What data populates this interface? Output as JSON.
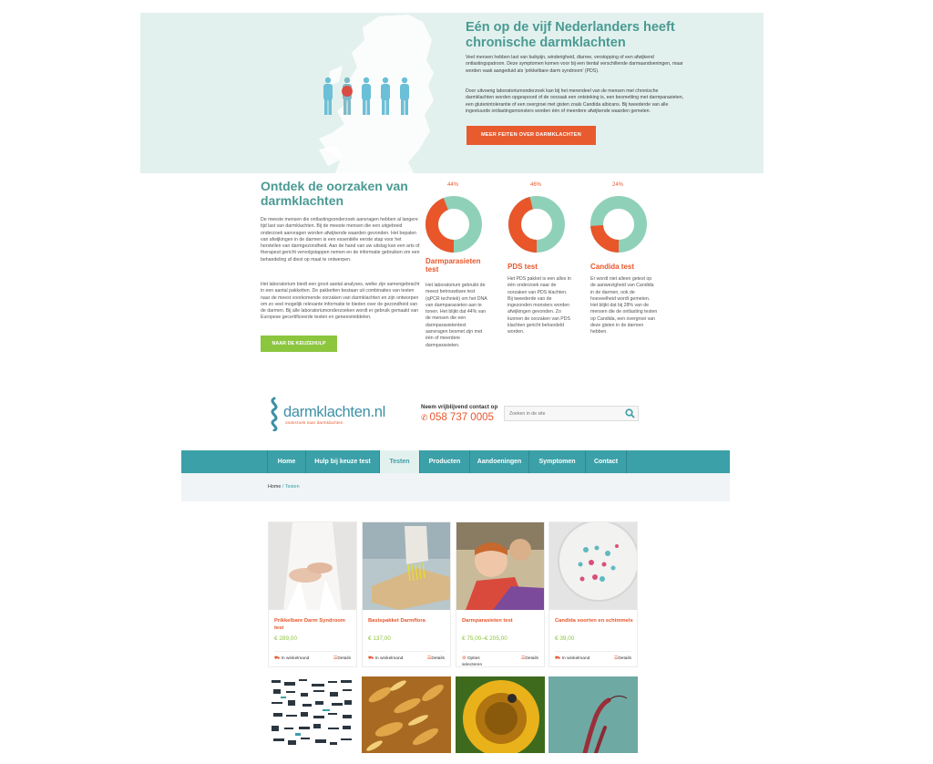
{
  "hero": {
    "title": "Eén op de vijf Nederlanders heeft chronische darmklachten",
    "p1": "Veel mensen hebben last van buikpijn, winderigheid, diarree, verstopping of een afwijkend ontlastingspatroon. Deze symptomen komen voor bij een tiental verschillende darmaandoeningen, maar worden vaak aangeduid als 'prikkelbare darm syndroom' (PDS).",
    "p2": "Door uitvoerig laboratoriumonderzoek kan bij het merendeel van de mensen met chronische darmklachten worden opgespoord of de oorzaak een ontsteking is, een besmetting met darmparasieten, een glutenintolerantie of een overgroei met gisten zoals Candida albicans. Bij tweederde van alle ingestuurde ontlastingsmonsters worden één of meerdere afwijkende waarden gemeten.",
    "button": "MEER FEITEN OVER DARMKLACHTEN"
  },
  "causes": {
    "title": "Ontdek de oorzaken van darmklachten",
    "p1": "De meeste mensen die ontlastingsonderzoek aanvragen hebben al langere tijd last van darmklachten. Bij de meeste mensen die een uitgebreid onderzoek aanvragen worden afwijkende waarden gevonden. Het bepalen van afwijkingen in de darmen is een essentiële eerste stap voor het herstellen van darmgezondheid. Aan de hand van uw uitslag kan een arts of therapeut gericht vervolgstappen nemen en de informatie gebruiken om een behandeling af diest op maat te ontwerpen.",
    "p2": "Het laboratorium biedt een groot aantal analyses, welke zijn samengebracht in een aantal pakketten. De pakketten bestaan uit combinaties van testen naar de meest voorkomende oorzaken van darmklachten en zijn ontworpen om zo veel mogelijk relevante informatie te bieden over de gezondheid van de darmen. Bij alle laboratoriumonderzoeken wordt er gebruik gemaakt van Europese gecertificeerde testen en geneesmiddelen.",
    "button": "NAAR DE KEUZEHULP"
  },
  "stats": [
    {
      "pct": "44%",
      "value": 44,
      "label": "Darmparasieten test",
      "text": "Het laboratorium gebruikt de meest betrouwbare test (qPCR techniek) om het DNA van darmparasieten aan te tonen. Het blijkt dat 44% van de mensen die een darmparasietentest aanvragen besmet zijn met één of meerdere darmparasieten."
    },
    {
      "pct": "46%",
      "value": 46,
      "label": "PDS test",
      "text": "Het PDS pakket is een alles in één onderzoek naar de oorzaken van PDS klachten. Bij tweederde van de ingezonden monsters worden afwijkingen gevonden. Zo kunnen de oorzaken van PDS klachten gericht behandeld worden."
    },
    {
      "pct": "24%",
      "value": 24,
      "label": "Candida test",
      "text": "Er wordt niet alleen getest op de aanwezigheid van Candida in de darmen, ook de hoeveelheid wordt gemeten. Het blijkt dat bij 28% van de mensen die de ontlasting testen op Candida, een overgroei van deze gisten in de darmen hebben."
    }
  ],
  "header": {
    "logo_text": "darmklachten.nl",
    "logo_sub": "onderzoek naar darmklachten",
    "contact_label": "Neem vrijblijvend contact op",
    "phone": "058 737 0005",
    "search_placeholder": "Zoeken in de site"
  },
  "nav": [
    "Home",
    "Hulp bij keuze test",
    "Testen",
    "Producten",
    "Aandoeningen",
    "Symptomen",
    "Contact"
  ],
  "breadcrumb": {
    "home": "Home",
    "sep": "/",
    "current": "Testen"
  },
  "products": [
    {
      "name": "Prikkelbare Darm Syndroom test",
      "price": "€ 289,00",
      "action": "In winkelmand",
      "details": "Details"
    },
    {
      "name": "Basispakket Darmflora",
      "price": "€ 137,00",
      "action": "In winkelmand",
      "details": "Details"
    },
    {
      "name": "Darmparasieten test",
      "price": "€ 75,00–€ 205,00",
      "action": "Opties selecteren",
      "details": "Details"
    },
    {
      "name": "Candida soorten en schimmels",
      "price": "€ 39,00",
      "action": "In winkelmand",
      "details": "Details"
    }
  ],
  "colors": {
    "teal": "#3ba0a7",
    "orange": "#e8562a",
    "green": "#8cc63f",
    "mint": "#8fd1b8"
  }
}
